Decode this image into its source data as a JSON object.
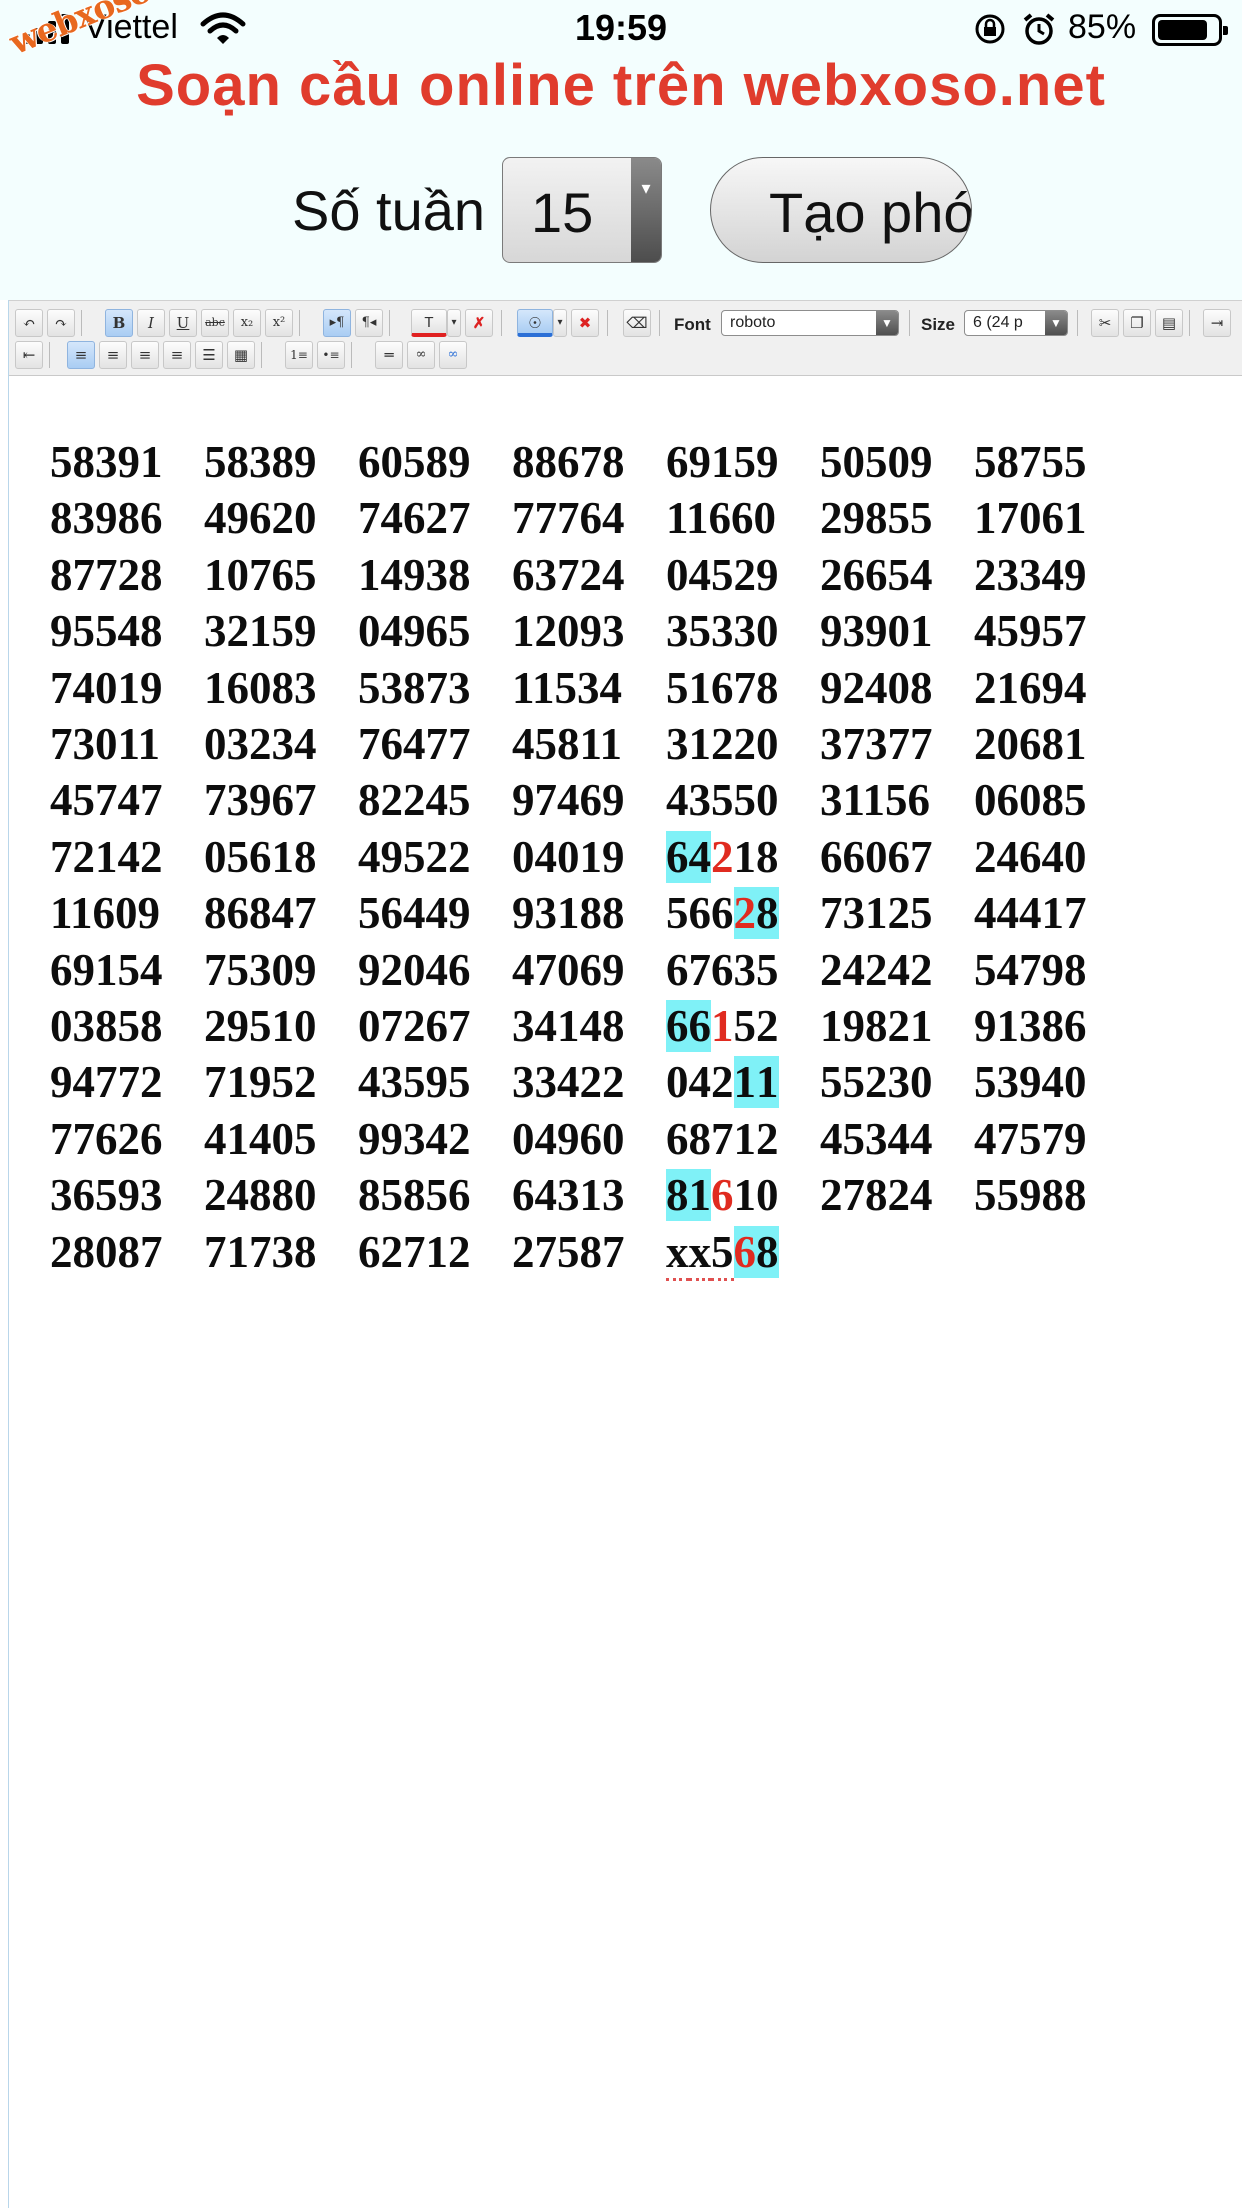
{
  "status_bar": {
    "carrier": "Viettel",
    "time": "19:59",
    "battery_percent": "85%",
    "battery_level": 0.85
  },
  "watermark": "webxoso.net",
  "header": {
    "title": "Soạn cầu online trên webxoso.net",
    "weeks_label": "Số tuần",
    "weeks_value": "15",
    "create_button": "Tạo phó"
  },
  "toolbar": {
    "font_label": "Font",
    "font_value": "roboto",
    "size_label": "Size",
    "size_value": "6 (24 p",
    "buttons_row1": [
      "undo-icon",
      "redo-icon",
      "bold-icon",
      "italic-icon",
      "underline-icon",
      "strikethrough-icon",
      "subscript-icon",
      "superscript-icon",
      "ltr-icon",
      "rtl-icon",
      "text-color-icon",
      "remove-format-icon",
      "highlight-color-icon",
      "remove-highlight-icon",
      "eraser-icon",
      "cut-icon",
      "copy-icon",
      "paste-icon",
      "indent-icon"
    ],
    "buttons_row2": [
      "outdent-icon",
      "align-left-icon",
      "align-left-2-icon",
      "align-center-icon",
      "align-right-icon",
      "justify-icon",
      "table-icon",
      "ordered-list-icon",
      "unordered-list-icon",
      "horizontal-rule-icon",
      "link-icon",
      "unlink-icon"
    ],
    "bold_label": "B",
    "italic_label": "I",
    "underline_label": "U",
    "strike_label": "abc",
    "sub_label": "x₂",
    "sup_label": "x²",
    "text_color_label": "T"
  },
  "highlight_color": "#7ff1f7",
  "red_color": "#e02b20",
  "rows": [
    [
      "58391",
      "58389",
      "60589",
      "88678",
      "69159",
      "50509",
      "58755"
    ],
    [
      "83986",
      "49620",
      "74627",
      "77764",
      "11660",
      "29855",
      "17061"
    ],
    [
      "87728",
      "10765",
      "14938",
      "63724",
      "04529",
      "26654",
      "23349"
    ],
    [
      "95548",
      "32159",
      "04965",
      "12093",
      "35330",
      "93901",
      "45957"
    ],
    [
      "74019",
      "16083",
      "53873",
      "11534",
      "51678",
      "92408",
      "21694"
    ],
    [
      "73011",
      "03234",
      "76477",
      "45811",
      "31220",
      "37377",
      "20681"
    ],
    [
      "45747",
      "73967",
      "82245",
      "97469",
      "43550",
      "31156",
      "06085"
    ],
    [
      "72142",
      "05618",
      "49522",
      "04019",
      "64218",
      "66067",
      "24640"
    ],
    [
      "11609",
      "86847",
      "56449",
      "93188",
      "56628",
      "73125",
      "44417"
    ],
    [
      "69154",
      "75309",
      "92046",
      "47069",
      "67635",
      "24242",
      "54798"
    ],
    [
      "03858",
      "29510",
      "07267",
      "34148",
      "66152",
      "19821",
      "91386"
    ],
    [
      "94772",
      "71952",
      "43595",
      "33422",
      "04211",
      "55230",
      "53940"
    ],
    [
      "77626",
      "41405",
      "99342",
      "04960",
      "68712",
      "45344",
      "47579"
    ],
    [
      "36593",
      "24880",
      "85856",
      "64313",
      "81610",
      "27824",
      "55988"
    ],
    [
      "28087",
      "71738",
      "62712",
      "27587",
      "xx568"
    ]
  ],
  "marked_cells": [
    {
      "row": 7,
      "col": 4,
      "highlight": [
        0,
        1
      ],
      "red": [
        2
      ]
    },
    {
      "row": 8,
      "col": 4,
      "highlight": [
        3,
        4
      ],
      "red": [
        3
      ]
    },
    {
      "row": 10,
      "col": 4,
      "highlight": [
        0,
        1
      ],
      "red": [
        2
      ]
    },
    {
      "row": 11,
      "col": 4,
      "highlight": [
        3,
        4
      ],
      "red": []
    },
    {
      "row": 13,
      "col": 4,
      "highlight": [
        0,
        1
      ],
      "red": [
        2
      ]
    },
    {
      "row": 14,
      "col": 4,
      "highlight": [
        3,
        4
      ],
      "red": [
        3
      ],
      "underline": [
        0,
        1,
        2
      ]
    }
  ]
}
